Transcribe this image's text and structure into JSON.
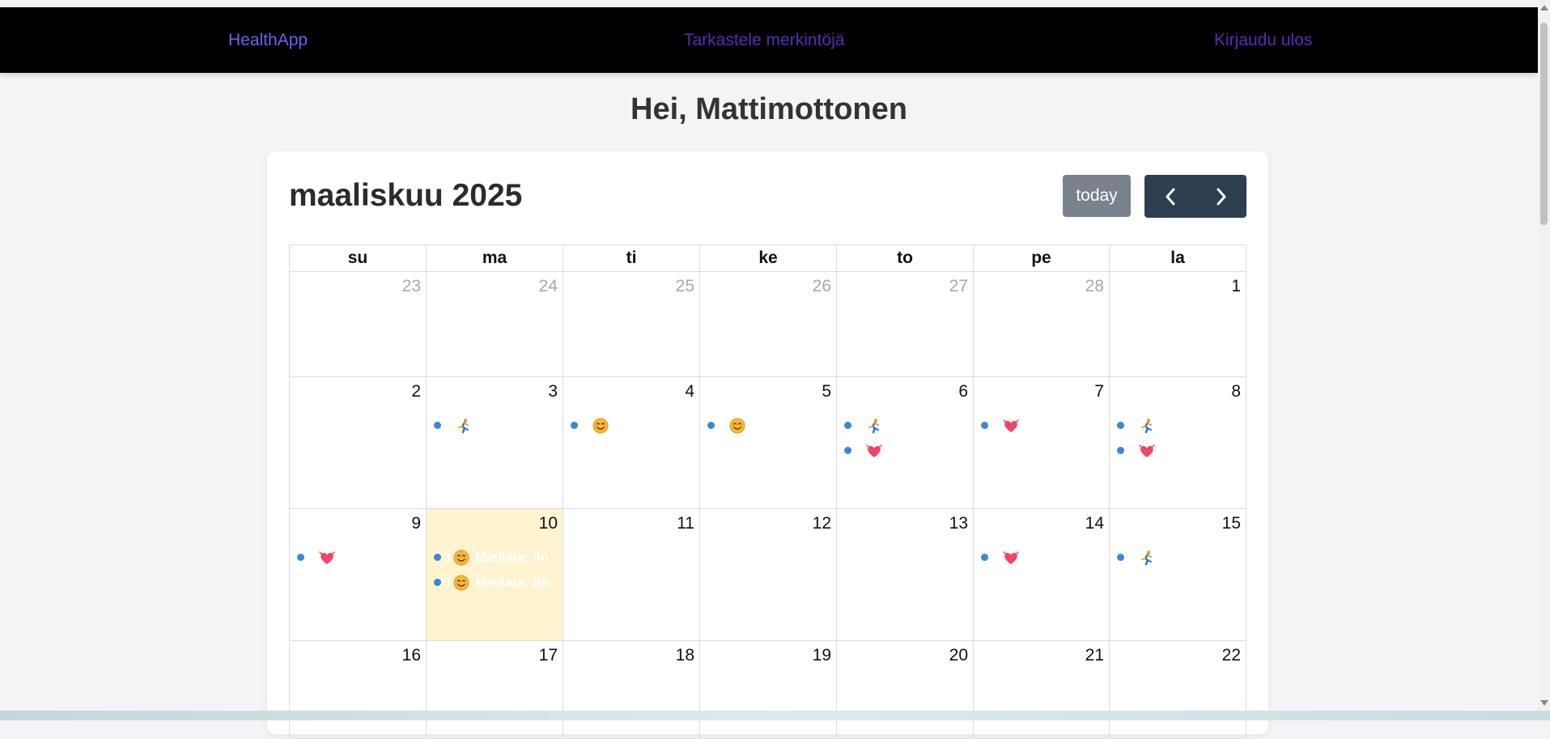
{
  "nav": {
    "brand": "HealthApp",
    "view_entries": "Tarkastele merkintöjä",
    "logout": "Kirjaudu ulos"
  },
  "greeting": "Hei, Mattimottonen",
  "calendar": {
    "title": "maaliskuu 2025",
    "today_button": "today",
    "weekdays": [
      "su",
      "ma",
      "ti",
      "ke",
      "to",
      "pe",
      "la"
    ],
    "weeks": [
      [
        {
          "day": "23",
          "events": []
        },
        {
          "day": "24",
          "events": []
        },
        {
          "day": "25",
          "events": []
        },
        {
          "day": "26",
          "events": []
        },
        {
          "day": "27",
          "events": []
        },
        {
          "day": "28",
          "events": []
        },
        {
          "day": "1",
          "events": []
        }
      ],
      [
        {
          "day": "2",
          "events": []
        },
        {
          "day": "3",
          "events": [
            {
              "icon": "runner-icon"
            }
          ]
        },
        {
          "day": "4",
          "events": [
            {
              "icon": "smiley-icon"
            }
          ]
        },
        {
          "day": "5",
          "events": [
            {
              "icon": "smiley-icon"
            }
          ]
        },
        {
          "day": "6",
          "events": [
            {
              "icon": "runner-icon"
            },
            {
              "icon": "heart-icon"
            }
          ]
        },
        {
          "day": "7",
          "events": [
            {
              "icon": "heart-icon"
            }
          ]
        },
        {
          "day": "8",
          "events": [
            {
              "icon": "runner-icon"
            },
            {
              "icon": "heart-icon"
            }
          ]
        }
      ],
      [
        {
          "day": "9",
          "events": [
            {
              "icon": "heart-icon"
            }
          ]
        },
        {
          "day": "10",
          "events": [
            {
              "icon": "smiley-icon",
              "time": "0",
              "text": "Mieliala: ilo"
            },
            {
              "icon": "smiley-icon",
              "time": "0",
              "text": "Mieliala: ilo"
            }
          ]
        },
        {
          "day": "11",
          "events": []
        },
        {
          "day": "12",
          "events": []
        },
        {
          "day": "13",
          "events": []
        },
        {
          "day": "14",
          "events": [
            {
              "icon": "heart-icon"
            }
          ]
        },
        {
          "day": "15",
          "events": [
            {
              "icon": "runner-icon"
            }
          ]
        }
      ],
      [
        {
          "day": "16",
          "events": []
        },
        {
          "day": "17",
          "events": []
        },
        {
          "day": "18",
          "events": []
        },
        {
          "day": "19",
          "events": []
        },
        {
          "day": "20",
          "events": []
        },
        {
          "day": "21",
          "events": []
        },
        {
          "day": "22",
          "events": []
        }
      ]
    ]
  },
  "colors": {
    "navbar_bg": "#000000",
    "brand_link": "#6b63f2",
    "nav_link": "#5a2bb8",
    "today_bg": "#fff3d0",
    "event_dot": "#3a87d6",
    "nav_buttons": "#2c3e50",
    "today_button": "#7a828e"
  }
}
